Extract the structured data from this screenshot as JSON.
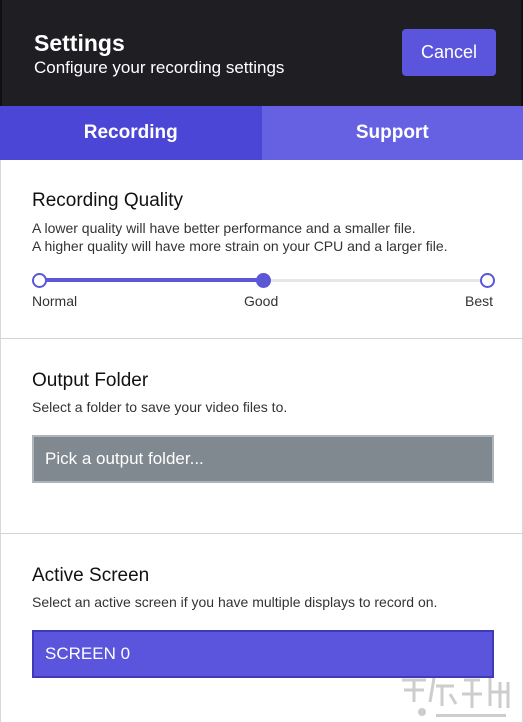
{
  "header": {
    "title": "Settings",
    "subtitle": "Configure your recording settings",
    "cancel_label": "Cancel"
  },
  "tabs": [
    {
      "label": "Recording",
      "active": true
    },
    {
      "label": "Support",
      "active": false
    }
  ],
  "recording_quality": {
    "title": "Recording Quality",
    "description_line1": "A lower quality will have better performance and a smaller file.",
    "description_line2": "A higher quality will have more strain on your CPU and a larger file.",
    "options": [
      "Normal",
      "Good",
      "Best"
    ],
    "selected": "Good"
  },
  "output_folder": {
    "title": "Output Folder",
    "description": "Select a folder to save your video files to.",
    "placeholder": "Pick a output folder..."
  },
  "active_screen": {
    "title": "Active Screen",
    "description": "Select an active screen if you have multiple displays to record on.",
    "value": "SCREEN 0"
  },
  "colors": {
    "accent": "#5a55dc",
    "tab_active": "#4b46d6",
    "tab_inactive": "#6661e3",
    "header_bg": "#1f1e23",
    "input_gray": "#808890"
  }
}
